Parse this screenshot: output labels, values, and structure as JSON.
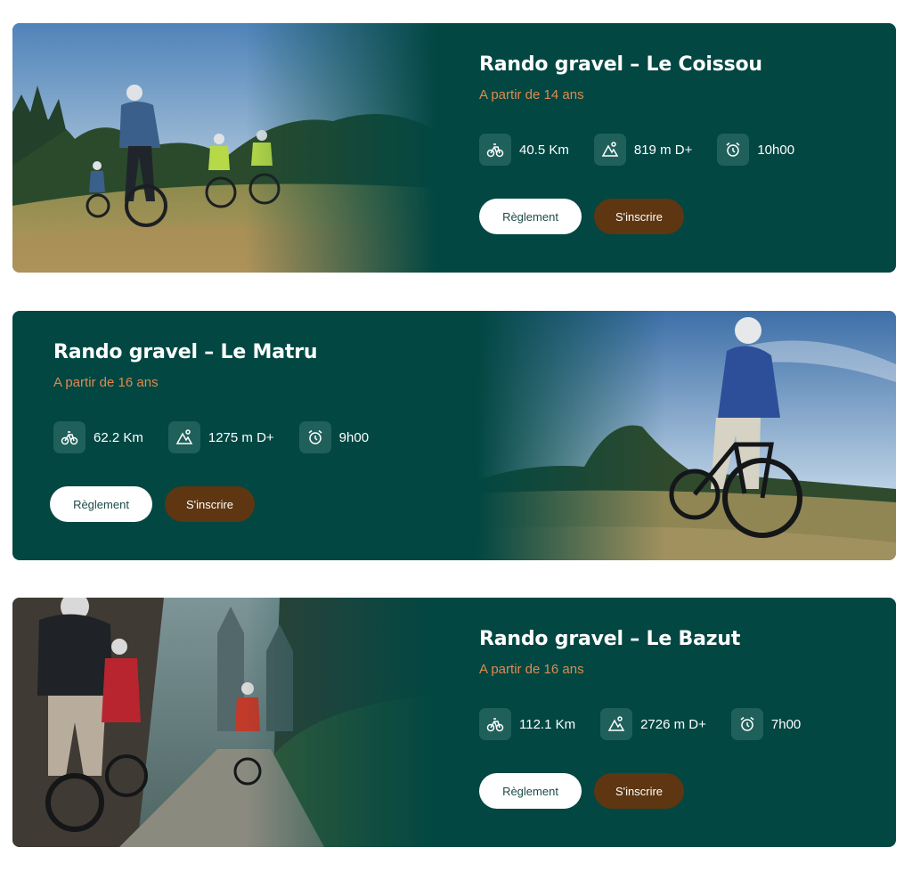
{
  "cards": [
    {
      "title": "Rando gravel – Le Coissou",
      "age": "A partir de 14 ans",
      "distance": "40.5 Km",
      "elevation": "819 m D+",
      "duration": "10h00",
      "rules_label": "Règlement",
      "signup_label": "S'inscrire"
    },
    {
      "title": "Rando gravel – Le Matru",
      "age": "A partir de 16 ans",
      "distance": "62.2 Km",
      "elevation": "1275 m D+",
      "duration": "9h00",
      "rules_label": "Règlement",
      "signup_label": "S'inscrire"
    },
    {
      "title": "Rando gravel – Le Bazut",
      "age": "A partir de 16 ans",
      "distance": "112.1 Km",
      "elevation": "2726 m D+",
      "duration": "7h00",
      "rules_label": "Règlement",
      "signup_label": "S'inscrire"
    }
  ],
  "icons": {
    "distance": "bike-icon",
    "elevation": "mountain-icon",
    "duration": "alarm-clock-icon"
  },
  "colors": {
    "card_bg": "#024742",
    "accent_orange": "#e08a4e",
    "signup_bg": "#5e3611",
    "icon_tile": "#1f605b"
  }
}
